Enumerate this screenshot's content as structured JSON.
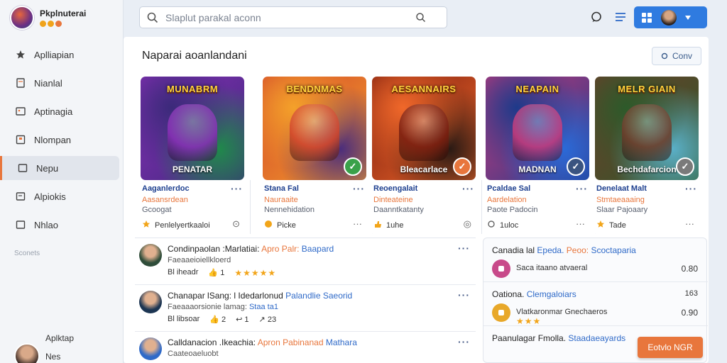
{
  "app": {
    "title": "Pkplnuterai",
    "accent_color": "#e8763c",
    "primary_color": "#2f7be0"
  },
  "sidebar": {
    "items": [
      {
        "label": "Aplliapian",
        "icon": "star-icon",
        "active": false
      },
      {
        "label": "Nianlal",
        "icon": "document-icon",
        "active": false
      },
      {
        "label": "Aptinagia",
        "icon": "image-icon",
        "active": false
      },
      {
        "label": "Nlompan",
        "icon": "flag-icon",
        "active": false
      },
      {
        "label": "Nepu",
        "icon": "folder-icon",
        "active": true
      },
      {
        "label": "Alpiokis",
        "icon": "bookmark-icon",
        "active": false
      },
      {
        "label": "Nhlao",
        "icon": "box-icon",
        "active": false
      }
    ],
    "section_label": "Sconets",
    "profile": {
      "line1": "Aplktap",
      "line2": "Nes"
    }
  },
  "search": {
    "placeholder": "Slaplut parakal aconn"
  },
  "main": {
    "section_title": "Naparai aoanlandani",
    "conv_button": "Conv"
  },
  "cards": [
    {
      "thumb_title": "MUNABRM",
      "thumb_sub": "PENATAR",
      "bg": [
        "#3b2a7a",
        "#8a2fb8",
        "#1f8a4a"
      ],
      "badge_color": "",
      "name": "Aaganlerdoc",
      "line2": "Aasansrdean",
      "line3": "Gcoogat",
      "footer": "Penlelyertkaaloi",
      "footer_icon": "star-icon",
      "action_icon": "pin-icon"
    },
    {
      "thumb_title": "BENDNMAS",
      "thumb_sub": "",
      "bg": [
        "#f4a12a",
        "#d2452c",
        "#4b2d7c"
      ],
      "badge_color": "#3aa14a",
      "name": "Stana Fal",
      "line2": "Nauraaite",
      "line3": "Nennehidation",
      "footer": "Picke",
      "footer_icon": "coin-icon",
      "action_icon": "dots-icon"
    },
    {
      "thumb_title": "AESANNAIRS",
      "thumb_sub": "Bleacarlace",
      "bg": [
        "#f0682a",
        "#7a1d0f",
        "#2a1a14"
      ],
      "badge_color": "#e8763c",
      "name": "Reoengalait",
      "line2": "Dinteateine",
      "line3": "Daanntkatanty",
      "footer": "1uhe",
      "footer_icon": "thumb-icon",
      "action_icon": "chat-icon"
    },
    {
      "thumb_title": "NEAPAIN",
      "thumb_sub": "MADNAN",
      "bg": [
        "#1e3a8a",
        "#c93a7a",
        "#2a6ad8"
      ],
      "badge_color": "#3a5480",
      "name": "Pcaldae Sal",
      "line2": "Aardelation",
      "line3": "Paote Padocin",
      "footer": "1uloc",
      "footer_icon": "refresh-icon",
      "action_icon": "dots-icon"
    },
    {
      "thumb_title": "MELR GIAIN",
      "thumb_sub": "Bechdafarcion",
      "bg": [
        "#2d5a2a",
        "#6f3c2a",
        "#5ab0c8"
      ],
      "badge_color": "#7a7a7a",
      "name": "Denelaat Malt",
      "line2": "Stmtaeaaaing",
      "line3": "Slaar Pajoaary",
      "footer": "Tade",
      "footer_icon": "star-icon",
      "action_icon": "dots-icon"
    }
  ],
  "feed": [
    {
      "title": "Condinpaolan :Marlatiai:",
      "accent": "Apro Palr:",
      "blue": "Baapard",
      "sub": "Faeaaeioiellkloerd",
      "meta1": "Bl iheadr",
      "meta2": "1",
      "rating": "★★★★★",
      "avatar_color": "#2f4d3a",
      "avatar_icon": "person-icon"
    },
    {
      "title": "Chanapar lSang: l  Idedarlonud",
      "accent": "",
      "blue": "Palandlie Saeorid",
      "sub": "Faeaaaorsionie lamag:",
      "blue2": "Staa ta1",
      "meta1": "Bl libsoar",
      "meta2": "2",
      "meta3": "1",
      "meta4": "23",
      "avatar_color": "#1c3552",
      "avatar_icon": "person-icon"
    },
    {
      "title": "Calldanacion .Ikeachia:",
      "accent": "Apron Pabinanad",
      "blue": "Mathara",
      "sub": "Caateoaeluobt",
      "rating": "★★★★",
      "avatar_color": "#2f6ac8",
      "avatar_icon": "star-badge-icon"
    }
  ],
  "side_panel": [
    {
      "title": "Canadia lal",
      "blue": "Epeda.",
      "accent": "Peoo:",
      "blue2": "Scoctaparia",
      "text": "Saca itaano atvaeral",
      "value": "0.80",
      "icon_color": "#c84a8a"
    },
    {
      "title": "Oationa.",
      "blue": "Clemgaloiars",
      "text": "Vlatkaronmar Gnechaeros",
      "value": "0.90",
      "top_value": "163",
      "rating": "★★★",
      "icon_color": "#e8a82a"
    },
    {
      "title": "Paanulagar Fmolla.",
      "blue": "Staadaeayards",
      "text": "",
      "value": ""
    }
  ],
  "cta": {
    "label": "Eotvlo NGR"
  }
}
